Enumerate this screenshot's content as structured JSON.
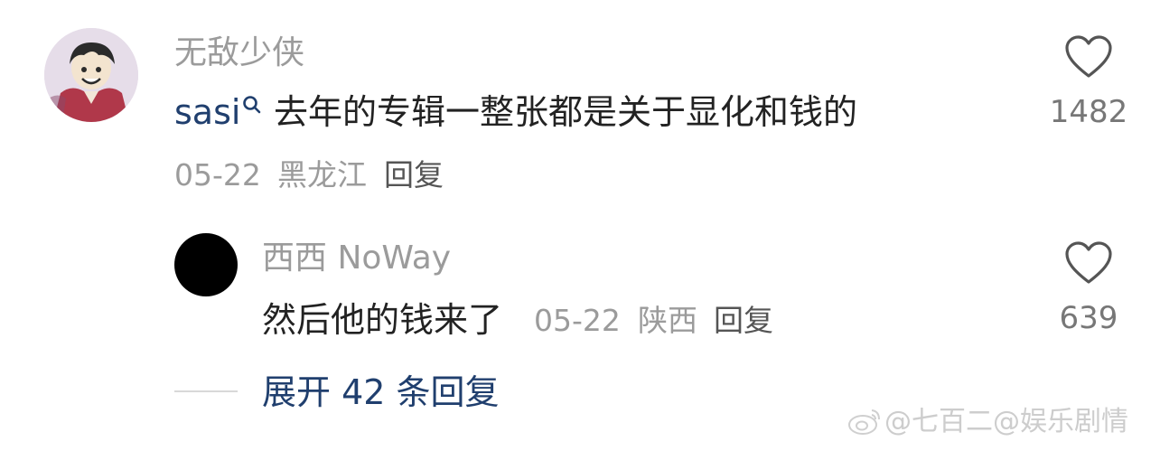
{
  "comment": {
    "username": "无敌少侠",
    "mention": "sasi",
    "text": "去年的专辑一整张都是关于显化和钱的",
    "date": "05-22",
    "location": "黑龙江",
    "reply_label": "回复",
    "like_count": "1482"
  },
  "reply": {
    "username": "西西 NoWay",
    "text": "然后他的钱来了",
    "date": "05-22",
    "location": "陕西",
    "reply_label": "回复",
    "like_count": "639"
  },
  "expand_replies_label": "展开 42 条回复",
  "watermark": "@七百二@娱乐剧情",
  "icons": {
    "like": "heart-outline-icon",
    "mention": "search-icon",
    "watermark": "weibo-logo-icon"
  },
  "colors": {
    "link": "#203f6e",
    "muted": "#9b9b9b",
    "text": "#222222"
  }
}
